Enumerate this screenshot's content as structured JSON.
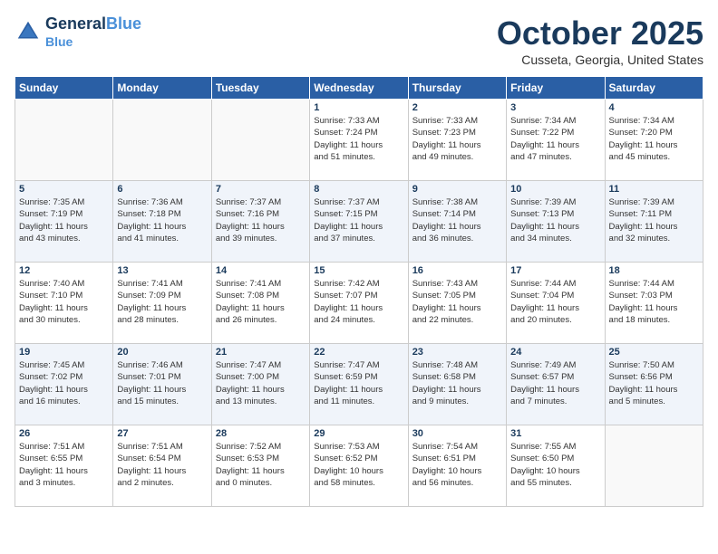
{
  "header": {
    "logo_line1": "General",
    "logo_line2": "Blue",
    "month": "October 2025",
    "location": "Cusseta, Georgia, United States"
  },
  "days_of_week": [
    "Sunday",
    "Monday",
    "Tuesday",
    "Wednesday",
    "Thursday",
    "Friday",
    "Saturday"
  ],
  "weeks": [
    [
      {
        "num": "",
        "info": ""
      },
      {
        "num": "",
        "info": ""
      },
      {
        "num": "",
        "info": ""
      },
      {
        "num": "1",
        "info": "Sunrise: 7:33 AM\nSunset: 7:24 PM\nDaylight: 11 hours\nand 51 minutes."
      },
      {
        "num": "2",
        "info": "Sunrise: 7:33 AM\nSunset: 7:23 PM\nDaylight: 11 hours\nand 49 minutes."
      },
      {
        "num": "3",
        "info": "Sunrise: 7:34 AM\nSunset: 7:22 PM\nDaylight: 11 hours\nand 47 minutes."
      },
      {
        "num": "4",
        "info": "Sunrise: 7:34 AM\nSunset: 7:20 PM\nDaylight: 11 hours\nand 45 minutes."
      }
    ],
    [
      {
        "num": "5",
        "info": "Sunrise: 7:35 AM\nSunset: 7:19 PM\nDaylight: 11 hours\nand 43 minutes."
      },
      {
        "num": "6",
        "info": "Sunrise: 7:36 AM\nSunset: 7:18 PM\nDaylight: 11 hours\nand 41 minutes."
      },
      {
        "num": "7",
        "info": "Sunrise: 7:37 AM\nSunset: 7:16 PM\nDaylight: 11 hours\nand 39 minutes."
      },
      {
        "num": "8",
        "info": "Sunrise: 7:37 AM\nSunset: 7:15 PM\nDaylight: 11 hours\nand 37 minutes."
      },
      {
        "num": "9",
        "info": "Sunrise: 7:38 AM\nSunset: 7:14 PM\nDaylight: 11 hours\nand 36 minutes."
      },
      {
        "num": "10",
        "info": "Sunrise: 7:39 AM\nSunset: 7:13 PM\nDaylight: 11 hours\nand 34 minutes."
      },
      {
        "num": "11",
        "info": "Sunrise: 7:39 AM\nSunset: 7:11 PM\nDaylight: 11 hours\nand 32 minutes."
      }
    ],
    [
      {
        "num": "12",
        "info": "Sunrise: 7:40 AM\nSunset: 7:10 PM\nDaylight: 11 hours\nand 30 minutes."
      },
      {
        "num": "13",
        "info": "Sunrise: 7:41 AM\nSunset: 7:09 PM\nDaylight: 11 hours\nand 28 minutes."
      },
      {
        "num": "14",
        "info": "Sunrise: 7:41 AM\nSunset: 7:08 PM\nDaylight: 11 hours\nand 26 minutes."
      },
      {
        "num": "15",
        "info": "Sunrise: 7:42 AM\nSunset: 7:07 PM\nDaylight: 11 hours\nand 24 minutes."
      },
      {
        "num": "16",
        "info": "Sunrise: 7:43 AM\nSunset: 7:05 PM\nDaylight: 11 hours\nand 22 minutes."
      },
      {
        "num": "17",
        "info": "Sunrise: 7:44 AM\nSunset: 7:04 PM\nDaylight: 11 hours\nand 20 minutes."
      },
      {
        "num": "18",
        "info": "Sunrise: 7:44 AM\nSunset: 7:03 PM\nDaylight: 11 hours\nand 18 minutes."
      }
    ],
    [
      {
        "num": "19",
        "info": "Sunrise: 7:45 AM\nSunset: 7:02 PM\nDaylight: 11 hours\nand 16 minutes."
      },
      {
        "num": "20",
        "info": "Sunrise: 7:46 AM\nSunset: 7:01 PM\nDaylight: 11 hours\nand 15 minutes."
      },
      {
        "num": "21",
        "info": "Sunrise: 7:47 AM\nSunset: 7:00 PM\nDaylight: 11 hours\nand 13 minutes."
      },
      {
        "num": "22",
        "info": "Sunrise: 7:47 AM\nSunset: 6:59 PM\nDaylight: 11 hours\nand 11 minutes."
      },
      {
        "num": "23",
        "info": "Sunrise: 7:48 AM\nSunset: 6:58 PM\nDaylight: 11 hours\nand 9 minutes."
      },
      {
        "num": "24",
        "info": "Sunrise: 7:49 AM\nSunset: 6:57 PM\nDaylight: 11 hours\nand 7 minutes."
      },
      {
        "num": "25",
        "info": "Sunrise: 7:50 AM\nSunset: 6:56 PM\nDaylight: 11 hours\nand 5 minutes."
      }
    ],
    [
      {
        "num": "26",
        "info": "Sunrise: 7:51 AM\nSunset: 6:55 PM\nDaylight: 11 hours\nand 3 minutes."
      },
      {
        "num": "27",
        "info": "Sunrise: 7:51 AM\nSunset: 6:54 PM\nDaylight: 11 hours\nand 2 minutes."
      },
      {
        "num": "28",
        "info": "Sunrise: 7:52 AM\nSunset: 6:53 PM\nDaylight: 11 hours\nand 0 minutes."
      },
      {
        "num": "29",
        "info": "Sunrise: 7:53 AM\nSunset: 6:52 PM\nDaylight: 10 hours\nand 58 minutes."
      },
      {
        "num": "30",
        "info": "Sunrise: 7:54 AM\nSunset: 6:51 PM\nDaylight: 10 hours\nand 56 minutes."
      },
      {
        "num": "31",
        "info": "Sunrise: 7:55 AM\nSunset: 6:50 PM\nDaylight: 10 hours\nand 55 minutes."
      },
      {
        "num": "",
        "info": ""
      }
    ]
  ]
}
